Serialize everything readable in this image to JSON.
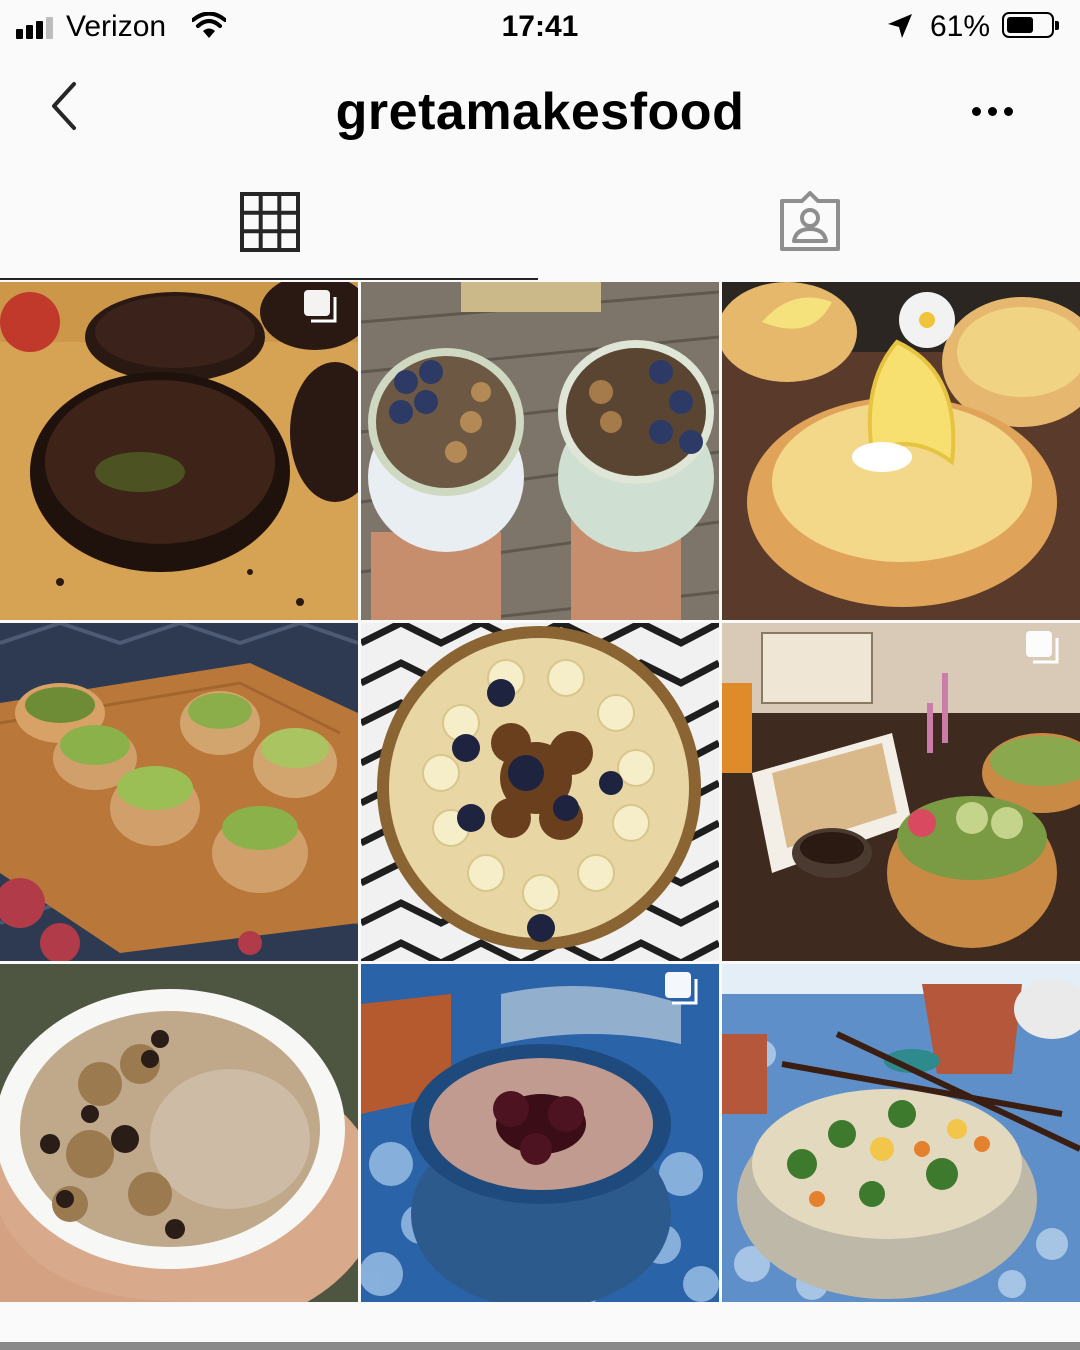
{
  "status_bar": {
    "carrier": "Verizon",
    "time": "17:41",
    "battery_percent": "61%",
    "battery_level": 0.61,
    "icons": [
      "cellular-signal-icon",
      "wifi-icon",
      "location-arrow-icon",
      "battery-icon"
    ]
  },
  "header": {
    "username": "gretamakesfood",
    "icons": [
      "back-chevron-icon",
      "more-options-icon"
    ]
  },
  "tabs": {
    "items": [
      {
        "name": "grid",
        "icon": "grid-icon",
        "selected": true
      },
      {
        "name": "tagged",
        "icon": "tagged-person-icon",
        "selected": false
      }
    ]
  },
  "posts": [
    {
      "subject": "chocolate tarts with matcha",
      "multi_photo": true
    },
    {
      "subject": "smoothie bowls with blueberries and granola",
      "multi_photo": false
    },
    {
      "subject": "lemon tart",
      "multi_photo": false
    },
    {
      "subject": "avocado toasts on wooden board",
      "multi_photo": false
    },
    {
      "subject": "banana granola smoothie bowl",
      "multi_photo": false
    },
    {
      "subject": "dumplings and salad bowls dinner",
      "multi_photo": true
    },
    {
      "subject": "oatmeal with chocolate chips",
      "multi_photo": false
    },
    {
      "subject": "pudding in blue bowl",
      "multi_photo": true
    },
    {
      "subject": "fried rice bowl with chopsticks",
      "multi_photo": false
    }
  ],
  "colors": {
    "background": "#fafafa",
    "text": "#000000",
    "icon_gray": "#262626",
    "tab_inactive": "#8e8e8e"
  }
}
